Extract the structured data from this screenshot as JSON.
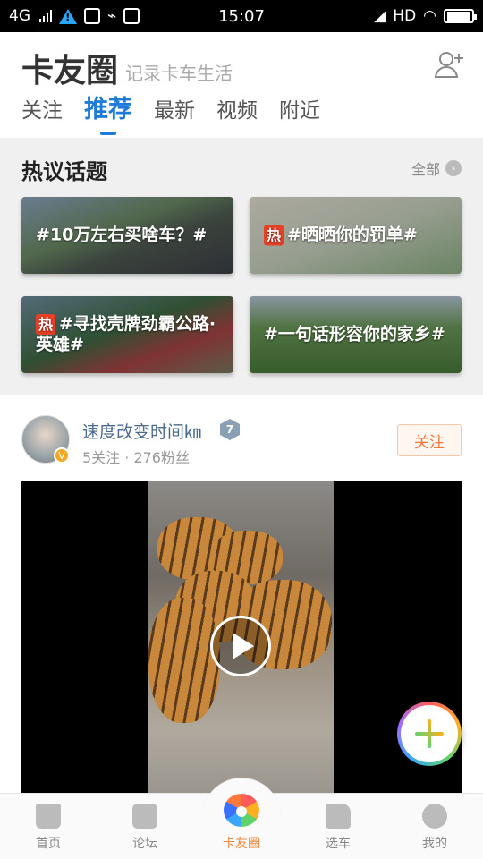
{
  "status_bar": {
    "network": "4G",
    "time": "15:07",
    "hd": "HD"
  },
  "header": {
    "title": "卡友圈",
    "subtitle": "记录卡车生活",
    "tabs": [
      "关注",
      "推荐",
      "最新",
      "视频",
      "附近"
    ],
    "active_tab": "推荐"
  },
  "hot_topics": {
    "title": "热议话题",
    "all_label": "全部",
    "hot_badge": "热",
    "cards": [
      {
        "label": "#10万左右买啥车？#",
        "hot": false
      },
      {
        "label": "#晒晒你的罚单#",
        "hot": true
      },
      {
        "label": "#寻找壳牌劲霸公路·英雄#",
        "hot": true
      },
      {
        "label": "#一句话形容你的家乡#",
        "hot": false
      }
    ]
  },
  "post": {
    "user_name": "速度改变时间㎞",
    "level": "7",
    "v_badge": "V",
    "stats": "5关注 · 276粉丝",
    "follow_label": "关注"
  },
  "bottom_nav": {
    "items": [
      {
        "label": "首页",
        "icon": "home-icon"
      },
      {
        "label": "论坛",
        "icon": "forum-icon"
      },
      {
        "label": "卡友圈",
        "icon": "pinwheel-icon",
        "active": true
      },
      {
        "label": "选车",
        "icon": "truck-icon"
      },
      {
        "label": "我的",
        "icon": "profile-icon"
      }
    ]
  },
  "colors": {
    "accent_blue": "#1f7bd8",
    "accent_orange": "#f0883c",
    "hot_red": "#e64026"
  }
}
